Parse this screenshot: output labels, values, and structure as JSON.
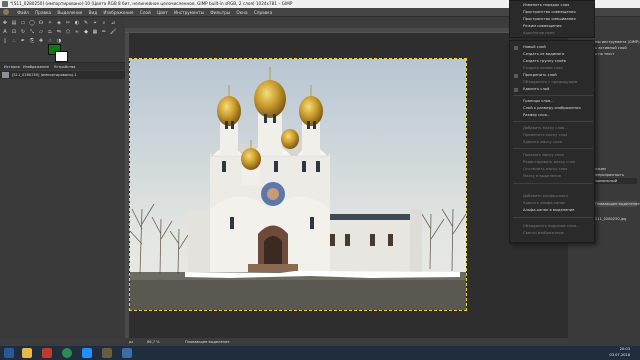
{
  "window": {
    "title": "*[S11_0280250] (импортировано)-10 (Цвета RGB 8 бит, нелинейное целочисленное, GIMP built-in sRGB, 2 слоя) 1024x781 – GIMP"
  },
  "menubar": {
    "items": [
      "Файл",
      "Правка",
      "Выделение",
      "Вид",
      "Изображение",
      "Слой",
      "Цвет",
      "Инструменты",
      "Фильтры",
      "Окна",
      "Справка"
    ]
  },
  "left_dock": {
    "tabs": [
      "История",
      "Изображения",
      "Устройства"
    ],
    "image_item": "[S11_0280250] (импортировано)-1"
  },
  "status": {
    "unit": "px",
    "zoom": "66,7 %",
    "message": "Плавающее выделение"
  },
  "right_dock": {
    "rows": [
      "мы инструмента (GIMP)",
      "ь активный слой",
      "ь на текст",
      "Режим",
      "Непрозрачность",
      "Нормальный",
      "Плавающее выделение",
      "S11_0280250.jpg"
    ]
  },
  "context_menu_top": {
    "items": [
      "Изменить порядок слоя",
      "Пространство совмещения",
      "Пространство смешивания",
      "Режим совмещения",
      "Удалённое поле"
    ]
  },
  "context_menu": {
    "groups": [
      [
        {
          "label": "Новый слой",
          "enabled": true
        },
        {
          "label": "Создать из видимого",
          "enabled": true
        },
        {
          "label": "Создать группу слоёв",
          "enabled": true
        },
        {
          "label": "Создать копию слоя",
          "enabled": false
        },
        {
          "label": "Прикрепить слой",
          "enabled": true
        },
        {
          "label": "Объединить с предыдущим",
          "enabled": false
        },
        {
          "label": "Удалить слой",
          "enabled": true
        }
      ],
      [
        {
          "label": "Границы слоя...",
          "enabled": true
        },
        {
          "label": "Слой к размеру изображения",
          "enabled": true
        },
        {
          "label": "Размер слоя...",
          "enabled": true
        }
      ],
      [
        {
          "label": "Добавить маску слоя...",
          "enabled": false
        },
        {
          "label": "Применить маску слоя",
          "enabled": false
        },
        {
          "label": "Удалить маску слоя",
          "enabled": false
        }
      ],
      [
        {
          "label": "Показать маску слоя",
          "enabled": false
        },
        {
          "label": "Редактировать маску слоя",
          "enabled": false
        },
        {
          "label": "Отключить маску слоя",
          "enabled": false
        },
        {
          "label": "Маску в выделение",
          "enabled": false
        }
      ],
      [
        {
          "label": "Добавить альфа-канал",
          "enabled": false
        },
        {
          "label": "Удалить альфа-канал",
          "enabled": false
        },
        {
          "label": "Альфа-канал в выделение",
          "enabled": true
        }
      ],
      [
        {
          "label": "Объединить видимые слои...",
          "enabled": false
        },
        {
          "label": "Свести изображение",
          "enabled": false
        }
      ]
    ]
  },
  "taskbar": {
    "time": "20:03",
    "date": "03.07.2018"
  },
  "colors": {
    "foreground": "#0c7a0c",
    "background": "#ffffff",
    "taskbar": "#1f2d3d"
  }
}
